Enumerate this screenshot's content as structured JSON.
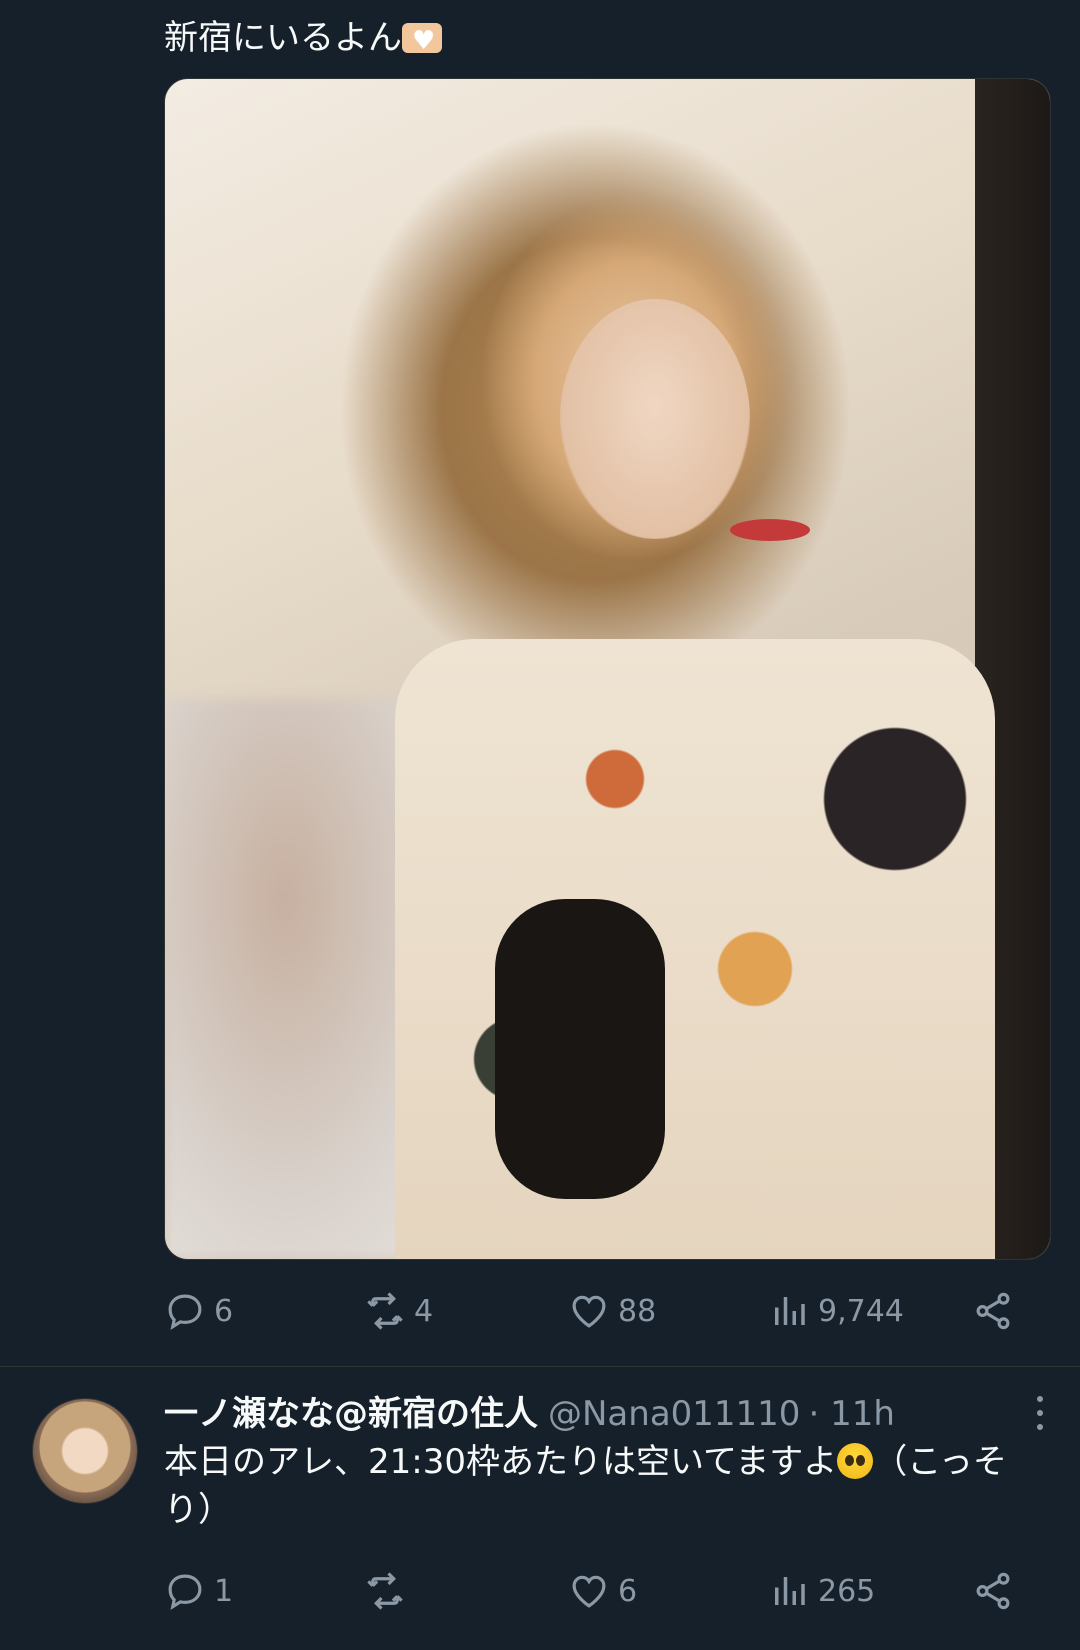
{
  "tweet1": {
    "text": "新宿にいるよん",
    "emoji": "heart-hands",
    "image_alt": "Selfie photo of a woman with wavy blonde hair in a floral dress",
    "stats": {
      "replies": "6",
      "retweets": "4",
      "likes": "88",
      "views": "9,744"
    }
  },
  "tweet2": {
    "display_name": "一ノ瀬なな@新宿の住人",
    "handle": "@Nana011110",
    "time": "· 11h",
    "text_before_emoji": "本日のアレ、21:30枠あたりは空いてますよ",
    "emoji": "pleading-face",
    "text_after_emoji": "（こっそり）",
    "stats": {
      "replies": "1",
      "retweets": "",
      "likes": "6",
      "views": "265"
    }
  },
  "colors": {
    "background": "#15202b",
    "text": "#f7f9f9",
    "muted": "#8b98a5",
    "divider": "#2f3336"
  }
}
